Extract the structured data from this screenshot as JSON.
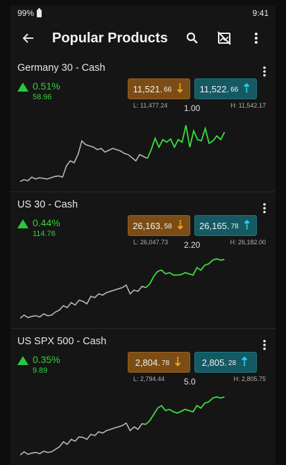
{
  "status": {
    "battery": "99%",
    "time": "9:41"
  },
  "appbar": {
    "title": "Popular Products",
    "icons": [
      "arrow-left-icon",
      "search-icon",
      "chart-off-icon",
      "more-vert-icon"
    ]
  },
  "colors": {
    "positive": "#34d23b",
    "sell_bg": "#7b4d16",
    "buy_bg": "#155963",
    "chart_old": "#b8b8b8",
    "chart_recent": "#3bdd3f"
  },
  "products": [
    {
      "name": "Germany 30 - Cash",
      "change_pct": "0.51%",
      "change_abs": "58.96",
      "sell_main": "11,521.",
      "sell_small": "66",
      "buy_main": "11,522.",
      "buy_small": "66",
      "low": "L: 11,477.24",
      "high": "H: 11,542.17",
      "spread": "1.00",
      "chart_data": {
        "type": "line",
        "series": [
          {
            "values": [
              5,
              8,
              6,
              12,
              9,
              11,
              10,
              9,
              11,
              13,
              14,
              12,
              30,
              38,
              35,
              48,
              70,
              64,
              62,
              60,
              56,
              58,
              52,
              55,
              58,
              56,
              54,
              50,
              48,
              43,
              38,
              48,
              45,
              42
            ]
          },
          {
            "values": [
              42,
              56,
              74,
              60,
              72,
              68,
              73,
              60,
              72,
              68,
              95,
              60,
              86,
              72,
              70,
              90,
              66,
              70,
              78,
              72,
              84
            ]
          }
        ]
      }
    },
    {
      "name": "US 30 - Cash",
      "change_pct": "0.44%",
      "change_abs": "114.76",
      "sell_main": "26,163.",
      "sell_small": "58",
      "buy_main": "26,165.",
      "buy_small": "78",
      "low": "L: 26,047.73",
      "high": "H: 26,182.00",
      "spread": "2.20",
      "chart_data": {
        "type": "line",
        "series": [
          {
            "values": [
              5,
              10,
              6,
              8,
              9,
              7,
              12,
              9,
              10,
              15,
              18,
              25,
              22,
              30,
              26,
              34,
              32,
              28,
              40,
              38,
              44,
              42,
              46,
              48,
              50,
              52,
              54,
              58,
              44,
              50,
              48,
              56,
              54
            ]
          },
          {
            "values": [
              54,
              60,
              72,
              80,
              82,
              76,
              78,
              74,
              74,
              75,
              78,
              76,
              74,
              86,
              82,
              90,
              92,
              98,
              100,
              98,
              99
            ]
          }
        ]
      }
    },
    {
      "name": "US SPX 500 - Cash",
      "change_pct": "0.35%",
      "change_abs": "9.89",
      "sell_main": "2,804.",
      "sell_small": "78",
      "buy_main": "2,805.",
      "buy_small": "28",
      "low": "L: 2,794.44",
      "high": "H: 2,805.75",
      "spread": "5.0",
      "chart_data": {
        "type": "line",
        "series": [
          {
            "values": [
              5,
              10,
              6,
              8,
              9,
              7,
              11,
              9,
              10,
              14,
              18,
              26,
              22,
              30,
              27,
              34,
              33,
              30,
              38,
              36,
              42,
              40,
              44,
              46,
              48,
              50,
              52,
              56,
              44,
              50,
              46,
              55,
              54
            ]
          },
          {
            "values": [
              54,
              60,
              70,
              80,
              84,
              76,
              78,
              74,
              72,
              75,
              78,
              76,
              74,
              84,
              80,
              88,
              90,
              96,
              98,
              96,
              98
            ]
          }
        ]
      }
    }
  ]
}
